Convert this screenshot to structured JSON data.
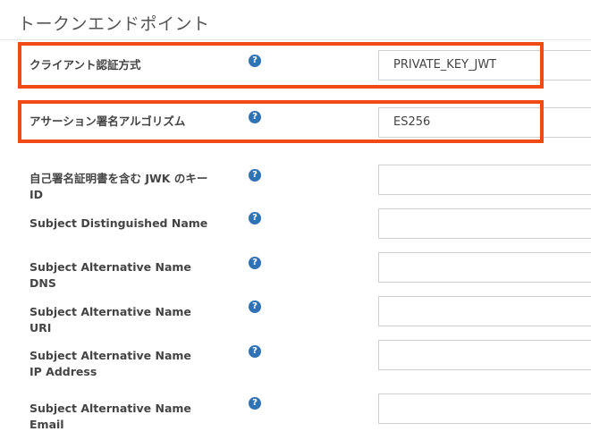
{
  "section": {
    "title": "トークンエンドポイント"
  },
  "rows": [
    {
      "label": "クライアント認証方式",
      "value": "PRIVATE_KEY_JWT"
    },
    {
      "label": "アサーション署名アルゴリズム",
      "value": "ES256"
    },
    {
      "label": "自己署名証明書を含む JWK のキー ID",
      "value": ""
    },
    {
      "label": "Subject Distinguished Name",
      "value": ""
    },
    {
      "label": "Subject Alternative Name DNS",
      "value": ""
    },
    {
      "label": "Subject Alternative Name URI",
      "value": ""
    },
    {
      "label": "Subject Alternative Name IP Address",
      "value": ""
    },
    {
      "label": "Subject Alternative Name Email",
      "value": ""
    }
  ],
  "help_glyph": "?",
  "colors": {
    "highlight": "#f04a16",
    "help_icon": "#2f73b5"
  }
}
